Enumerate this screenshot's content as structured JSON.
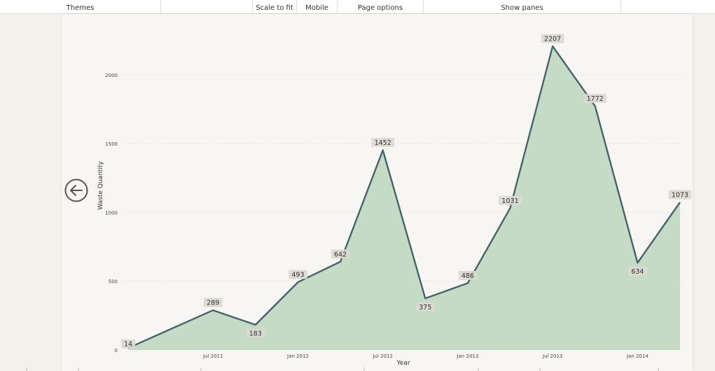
{
  "toolbar": {
    "themes": "Themes",
    "scale_to_fit": "Scale to fit",
    "mobile": "Mobile",
    "page_options": "Page options",
    "show_panes": "Show panes"
  },
  "icons": {
    "back": "back-arrow-icon"
  },
  "colors": {
    "line": "#44636b",
    "area": "#c5dbc6",
    "label_bg": "#dcd9d3",
    "grid": "#d8d6d0"
  },
  "chart_data": {
    "type": "area",
    "title": "",
    "xlabel": "Year",
    "ylabel": "Waste Quantity",
    "ylim": [
      0,
      2000
    ],
    "yticks": [
      0,
      500,
      1000,
      1500,
      2000
    ],
    "xtick_labels": [
      "Jul 2011",
      "Jan 2012",
      "Jul 2012",
      "Jan 2013",
      "Jul 2013",
      "Jan 2014"
    ],
    "x": [
      "Jan 2011",
      "Jul 2011",
      "Oct 2011",
      "Jan 2012",
      "Apr 2012",
      "Jul 2012",
      "Oct 2012",
      "Jan 2013",
      "Apr 2013",
      "Jul 2013",
      "Oct 2013",
      "Jan 2014",
      "Apr 2014"
    ],
    "values": [
      14,
      289,
      183,
      493,
      642,
      1452,
      375,
      486,
      1031,
      2207,
      1772,
      634,
      1073
    ],
    "data_labels": [
      "14",
      "289",
      "183",
      "493",
      "642",
      "1452",
      "375",
      "486",
      "1031",
      "2207",
      "1772",
      "634",
      "1073"
    ],
    "grid": true,
    "grid_style": "dotted horizontal"
  }
}
